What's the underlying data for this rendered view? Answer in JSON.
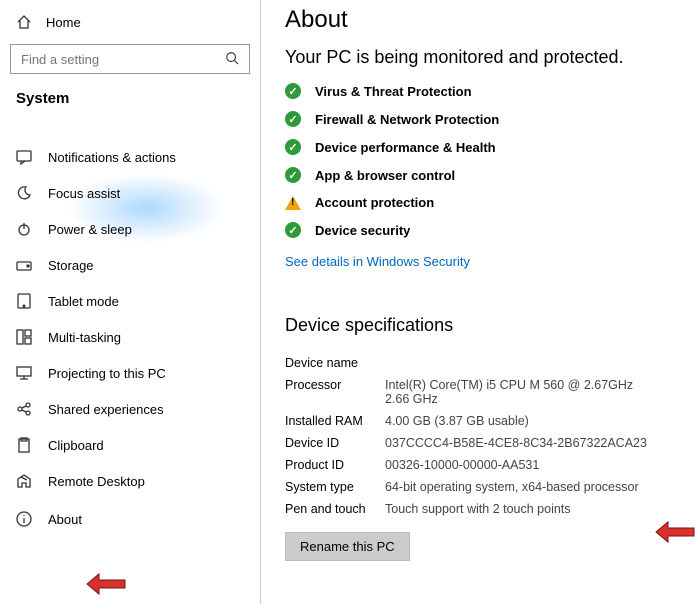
{
  "sidebar": {
    "home": "Home",
    "search_placeholder": "Find a setting",
    "section": "System",
    "items": [
      {
        "label": "Notifications & actions"
      },
      {
        "label": "Focus assist"
      },
      {
        "label": "Power & sleep"
      },
      {
        "label": "Storage"
      },
      {
        "label": "Tablet mode"
      },
      {
        "label": "Multi-tasking"
      },
      {
        "label": "Projecting to this PC"
      },
      {
        "label": "Shared experiences"
      },
      {
        "label": "Clipboard"
      },
      {
        "label": "Remote Desktop"
      },
      {
        "label": "About"
      }
    ]
  },
  "main": {
    "title": "About",
    "subhead": "Your PC is being monitored and protected.",
    "status": [
      {
        "label": "Virus & Threat Protection",
        "ok": true
      },
      {
        "label": "Firewall & Network Protection",
        "ok": true
      },
      {
        "label": "Device performance & Health",
        "ok": true
      },
      {
        "label": "App & browser control",
        "ok": true
      },
      {
        "label": "Account protection",
        "ok": false
      },
      {
        "label": "Device security",
        "ok": true
      }
    ],
    "link": "See details in Windows Security",
    "spec_header": "Device specifications",
    "specs": {
      "device_name_label": "Device name",
      "device_name_val": "",
      "processor_label": "Processor",
      "processor_val": "Intel(R) Core(TM) i5 CPU       M 560  @ 2.67GHz   2.66 GHz",
      "ram_label": "Installed RAM",
      "ram_val": "4.00 GB (3.87 GB usable)",
      "device_id_label": "Device ID",
      "device_id_val": "037CCCC4-B58E-4CE8-8C34-2B67322ACA23",
      "product_id_label": "Product ID",
      "product_id_val": "00326-10000-00000-AA531",
      "system_type_label": "System type",
      "system_type_val": "64-bit operating system, x64-based processor",
      "pen_label": "Pen and touch",
      "pen_val": "Touch support with 2 touch points"
    },
    "rename_btn": "Rename this PC"
  }
}
